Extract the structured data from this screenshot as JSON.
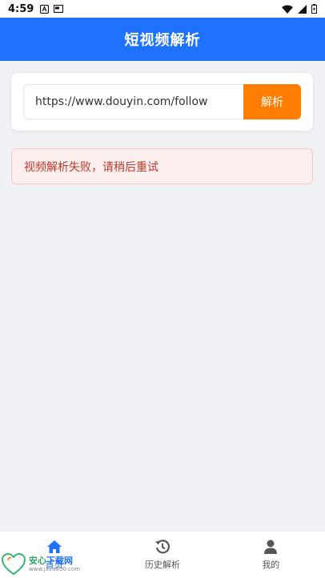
{
  "status_bar": {
    "time": "4:59",
    "left_icons": [
      "a-icon",
      "window-icon"
    ],
    "right_icons": [
      "wifi-icon",
      "signal-icon",
      "battery-icon"
    ]
  },
  "header": {
    "title": "短视频解析",
    "bg_color": "#1f72ff"
  },
  "search": {
    "url_value": "https://www.douyin.com/follow",
    "button_label": "解析",
    "button_color": "#ff7d00"
  },
  "alert": {
    "message": "视频解析失败，请稍后重试"
  },
  "bottom_nav": {
    "items": [
      {
        "label": "首页",
        "icon": "home-icon",
        "active": true
      },
      {
        "label": "历史解析",
        "icon": "history-icon",
        "active": false
      },
      {
        "label": "我的",
        "icon": "user-icon",
        "active": false
      }
    ]
  },
  "watermark": {
    "name_a": "安心",
    "name_b": "下载网",
    "url": "www.java800.com"
  }
}
